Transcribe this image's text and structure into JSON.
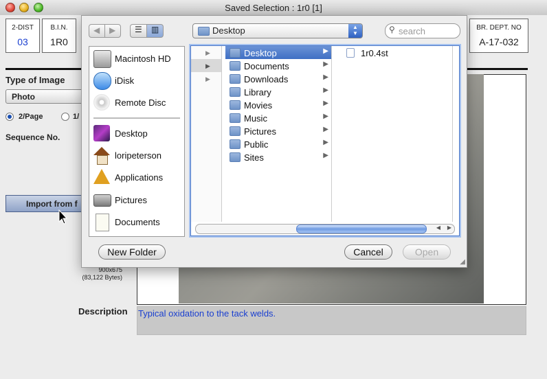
{
  "window": {
    "title": "Saved Selection : 1r0 [1]"
  },
  "form": {
    "dist": {
      "label": "2-DIST",
      "value": "03"
    },
    "bin": {
      "label": "B.I.N.",
      "value": "1R0"
    },
    "dept": {
      "label": "BR. DEPT. NO",
      "value": "A-17-032"
    },
    "type_label": "Type of Image",
    "type_value": "Photo",
    "radio_1": "2/Page",
    "radio_2": "1/",
    "sequence_label": "Sequence No.",
    "import_label": "Import from f",
    "image_dims": "900x675",
    "image_bytes": "(83,122 Bytes)",
    "description_label": "Description",
    "description_value": "Typical oxidation to the tack welds."
  },
  "dialog": {
    "location": "Desktop",
    "search_placeholder": "search",
    "sidebar": [
      {
        "label": "Macintosh HD",
        "icon": "hard-drive-icon"
      },
      {
        "label": "iDisk",
        "icon": "idisk-icon"
      },
      {
        "label": "Remote Disc",
        "icon": "disc-icon"
      },
      {
        "label": "Desktop",
        "icon": "desktop-icon"
      },
      {
        "label": "loripeterson",
        "icon": "home-icon"
      },
      {
        "label": "Applications",
        "icon": "applications-icon"
      },
      {
        "label": "Pictures",
        "icon": "camera-icon"
      },
      {
        "label": "Documents",
        "icon": "document-icon"
      }
    ],
    "folders": [
      "Desktop",
      "Documents",
      "Downloads",
      "Library",
      "Movies",
      "Music",
      "Pictures",
      "Public",
      "Sites"
    ],
    "files": [
      "1r0.4st"
    ],
    "new_folder": "New Folder",
    "cancel": "Cancel",
    "open": "Open"
  },
  "colors": {
    "selection": "#3f6fc4",
    "link_blue": "#1a3fd0"
  }
}
